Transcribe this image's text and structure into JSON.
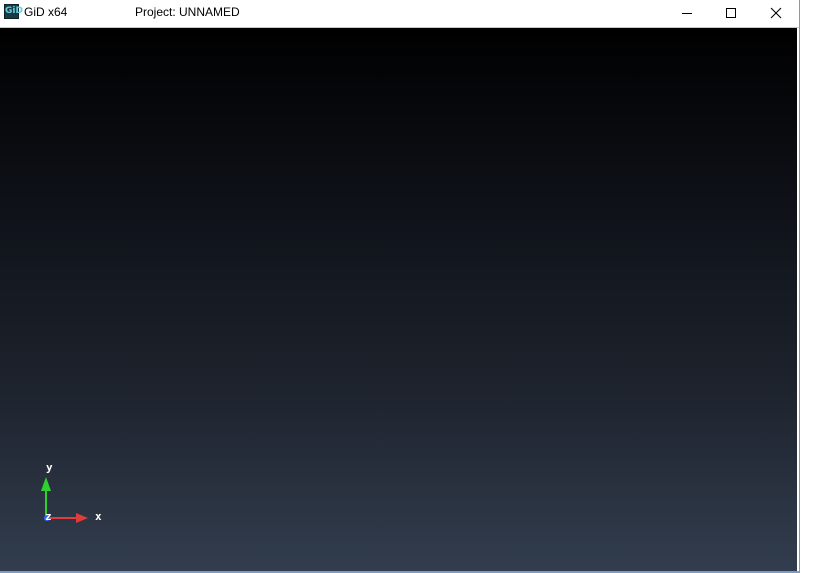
{
  "window": {
    "app_name": "GiD x64",
    "app_icon_text": "GiD",
    "project_title": "Project: UNNAMED"
  },
  "controls": {
    "minimize": "minimize-icon",
    "maximize": "maximize-icon",
    "close": "close-icon"
  },
  "axes": {
    "x_label": "x",
    "y_label": "y",
    "z_label": "z"
  },
  "colors": {
    "viewport_top": "#000000",
    "viewport_bottom": "#323d4e",
    "x_axis": "#e23b3b",
    "y_axis": "#2fd12f",
    "z_axis": "#2a6cff",
    "window_border": "#7a9cc4"
  }
}
